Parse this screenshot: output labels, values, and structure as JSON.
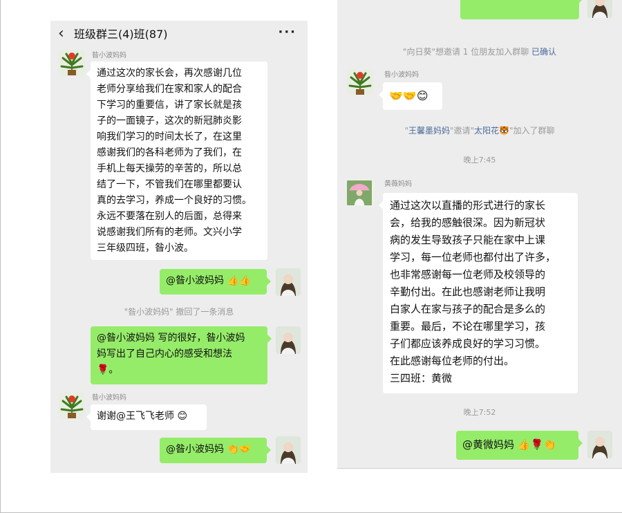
{
  "left_chat": {
    "title": "班级群三(4)班(87)",
    "back_icon": "‹",
    "more_icon": "···",
    "messages": [
      {
        "sender": "昝小波妈妈",
        "text": "通过这次的家长会，再次感谢几位\n老师分享给我们在家和家人的配合\n下学习的重要信，讲了家长就是孩\n子的一面镜子，这次的新冠肺炎影\n响我们学习的时间太长了，在这里\n感谢我们的各科老师为了我们，在\n手机上每天操劳的辛苦的，所以总\n结了一下，不管我们在哪里都要认\n真的去学习，养成一个良好的习惯。\n永远不要落在别人的后面，总得来\n说感谢我们所有的老师。文兴小学\n三年级四班，昝小波。"
      },
      {
        "text": "@昝小波妈妈 👍👍"
      },
      {
        "text": "\"昝小波妈妈\" 撤回了一条消息"
      },
      {
        "text": "@昝小波妈妈  写的很好，昝小波妈\n妈写出了自己内心的感受和想法\n🌹。"
      },
      {
        "sender": "昝小波妈妈",
        "text": "谢谢@王飞飞老师 😊"
      },
      {
        "text": "@昝小波妈妈 👏🤝"
      }
    ]
  },
  "right_chat": {
    "system_invite_1": {
      "text": "\"向日葵\"想邀请 1 位朋友加入群聊 ",
      "link": "已确认"
    },
    "messages": [
      {
        "sender": "昝小波妈妈",
        "text": "🤝🤝😊"
      },
      {
        "sender": "黄薇妈妈",
        "text": "通过这次以直播的形式进行的家长\n会，给我的感触很深。因为新冠状\n病的发生导致孩子只能在家中上课\n学习，每一位老师也都付出了许多，\n也非常感谢每一位老师及校领导的\n辛勤付出。在此也感谢老师让我明\n白家人在家与孩子的配合是多么的\n重要。最后，不论在哪里学习，孩\n子们都应该养成良好的学习习惯。\n在此感谢每位老师的付出。\n                三四班：黄微"
      },
      {
        "text": "@黄微妈妈 👍🌹👏"
      }
    ],
    "system_invite_2": {
      "pre": "\"",
      "name1": "王馨墨妈妈",
      "mid": "\"邀请\"",
      "name2": "太阳花🐯",
      "post": "\"加入了群聊"
    },
    "time_1": "晚上7:45",
    "time_2": "晚上7:52"
  },
  "colors": {
    "chat_bg": "#ededed",
    "bubble_green": "#95ec69",
    "bubble_white": "#ffffff",
    "link_blue": "#4a6a9b"
  },
  "icons": {
    "back": "chevron-left-icon",
    "more": "more-dots-icon"
  }
}
